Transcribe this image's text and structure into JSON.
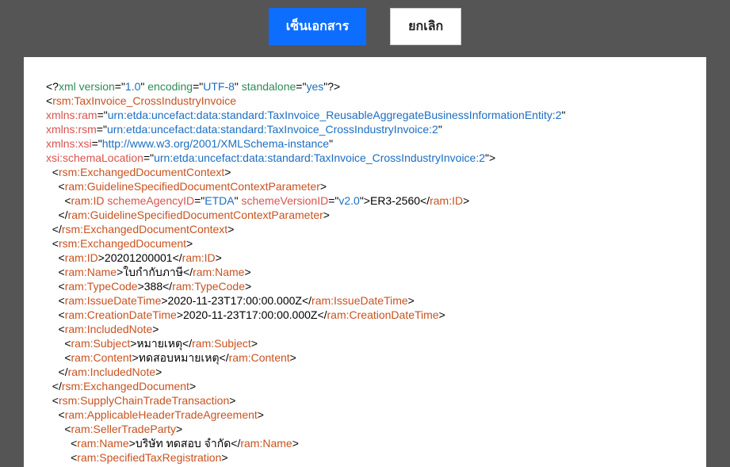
{
  "toolbar": {
    "sign_label": "เซ็นเอกสาร",
    "cancel_label": "ยกเลิก"
  },
  "xml": {
    "prolog_version": "1.0",
    "prolog_encoding": "UTF-8",
    "prolog_standalone": "yes",
    "root": "rsm:TaxInvoice_CrossIndustryInvoice",
    "xmlns_ram": "urn:etda:uncefact:data:standard:TaxInvoice_ReusableAggregateBusinessInformationEntity:2",
    "xmlns_rsm": "urn:etda:uncefact:data:standard:TaxInvoice_CrossIndustryInvoice:2",
    "xmlns_xsi": "http://www.w3.org/2001/XMLSchema-instance",
    "schema_location": "urn:etda:uncefact:data:standard:TaxInvoice_CrossIndustryInvoice:2",
    "guideline_scheme_agency": "ETDA",
    "guideline_scheme_version": "v2.0",
    "guideline_id": "ER3-2560",
    "doc_id": "20201200001",
    "doc_name": "ใบกำกับภาษี",
    "doc_typecode": "388",
    "issue_datetime": "2020-11-23T17:00:00.000Z",
    "creation_datetime": "2020-11-23T17:00:00.000Z",
    "note_subject": "หมายเหตุ",
    "note_content": "ทดสอบหมายเหตุ",
    "seller_name": "บริษัท ทดสอบ จำกัด"
  }
}
